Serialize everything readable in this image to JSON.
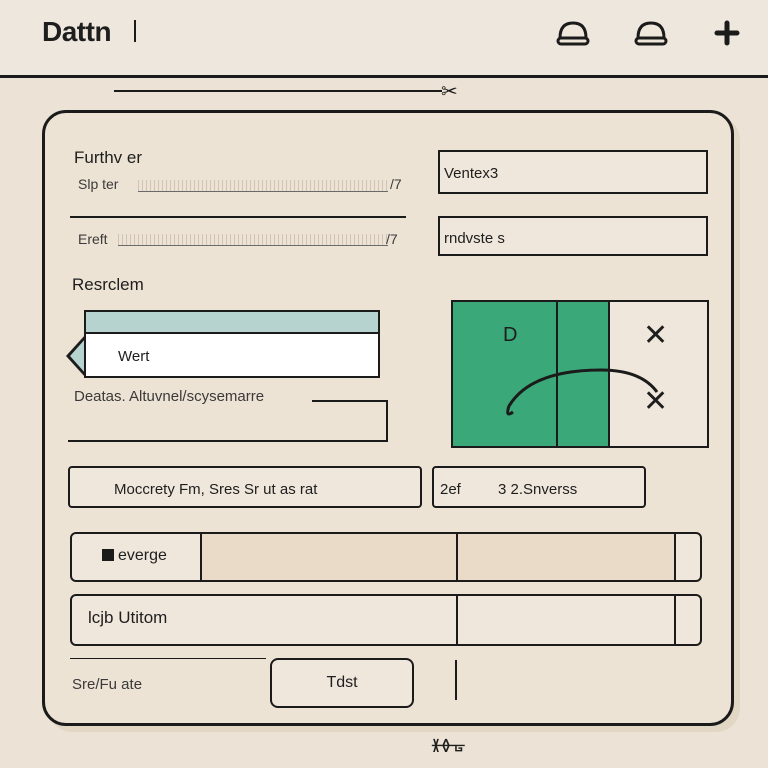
{
  "header": {
    "title": "Dattn",
    "icons": [
      "bell-dome-icon",
      "bell-dome-icon",
      "plus-icon"
    ]
  },
  "form": {
    "field1": {
      "label": "Furthv er",
      "sub_label": "Slp ter",
      "suffix": "/7"
    },
    "field2": {
      "label": "Ereft",
      "suffix": "/7"
    },
    "right_inputs": [
      {
        "value": "Ventex3"
      },
      {
        "value": "rndvste s"
      }
    ],
    "section_label": "Resrclem",
    "dropdown": {
      "selected": "Wert"
    },
    "description_label": "Deatas. Altuvnel/scysemarre",
    "green_panel": {
      "letter": "D",
      "close_top": "✕",
      "close_bottom": "✕"
    },
    "wide_field": {
      "value": "Moccrety Fm, Sres Sr ut as rat"
    },
    "right_field": {
      "prefix": "2ef",
      "value": "3 2.Snverss"
    },
    "row1": {
      "label": "everge",
      "icon": "checkbox-icon"
    },
    "row2": {
      "label": "lcjb Utitom"
    },
    "footer": {
      "label": "Sre/Fu ate",
      "button_label": "Tdst"
    }
  },
  "footer_mark": "ᚕᚖᚗ"
}
